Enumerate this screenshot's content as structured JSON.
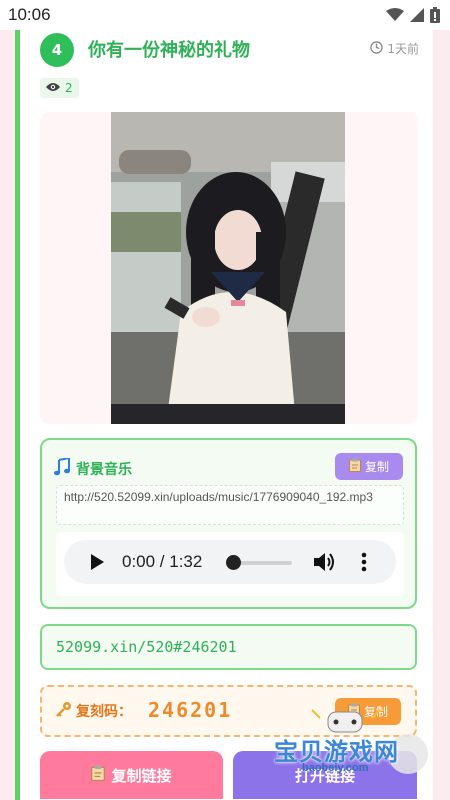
{
  "status_bar": {
    "time": "10:06"
  },
  "card": {
    "index": "4",
    "title": "你有一份神秘的礼物",
    "time_ago": "1天前",
    "views": "2"
  },
  "music": {
    "title": "背景音乐",
    "copy_label": "复制",
    "url": "http://520.52099.xin/uploads/music/1776909040_192.mp3",
    "current_time": "0:00 / 1:32",
    "progress": 0
  },
  "link": {
    "text": "52099.xin/520#246201"
  },
  "code": {
    "label": "复刻码：",
    "value": "246201",
    "copy_label": "复制"
  },
  "actions": {
    "copy_link_label": "复制链接",
    "open_link_label": "打开链接"
  },
  "watermark": {
    "text": "宝贝游戏网",
    "sub": "baobeiy.com"
  },
  "colors": {
    "accent_green": "#2fb257",
    "pink": "#ff7a9c",
    "purple": "#8c73ea",
    "orange": "#f79b38"
  }
}
